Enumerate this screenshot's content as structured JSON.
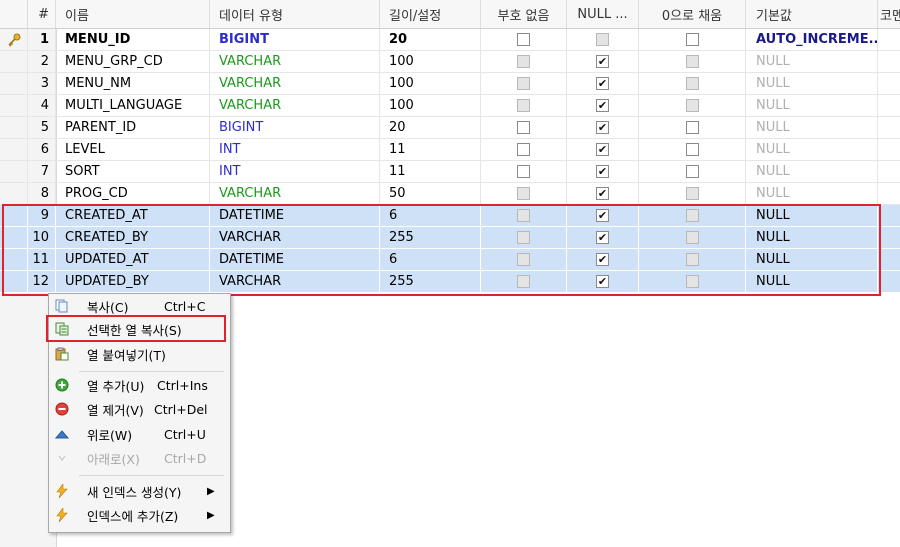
{
  "columns": {
    "num": "#",
    "name": "이름",
    "type": "데이터 유형",
    "length": "길이/설정",
    "unsigned": "부호 없음",
    "null": "NULL ...",
    "zerofill": "0으로 채움",
    "default": "기본값",
    "comment": "코멘"
  },
  "rows": [
    {
      "num": "1",
      "name": "MENU_ID",
      "type": "BIGINT",
      "length": "20",
      "unsigned": false,
      "null": false,
      "zerofill": false,
      "default": "AUTO_INCREME...",
      "primary_key": true
    },
    {
      "num": "2",
      "name": "MENU_GRP_CD",
      "type": "VARCHAR",
      "length": "100",
      "unsigned": false,
      "null": true,
      "zerofill": false,
      "default": "NULL"
    },
    {
      "num": "3",
      "name": "MENU_NM",
      "type": "VARCHAR",
      "length": "100",
      "unsigned": false,
      "null": true,
      "zerofill": false,
      "default": "NULL"
    },
    {
      "num": "4",
      "name": "MULTI_LANGUAGE",
      "type": "VARCHAR",
      "length": "100",
      "unsigned": false,
      "null": true,
      "zerofill": false,
      "default": "NULL"
    },
    {
      "num": "5",
      "name": "PARENT_ID",
      "type": "BIGINT",
      "length": "20",
      "unsigned": false,
      "null": true,
      "zerofill": false,
      "default": "NULL"
    },
    {
      "num": "6",
      "name": "LEVEL",
      "type": "INT",
      "length": "11",
      "unsigned": false,
      "null": true,
      "zerofill": false,
      "default": "NULL"
    },
    {
      "num": "7",
      "name": "SORT",
      "type": "INT",
      "length": "11",
      "unsigned": false,
      "null": true,
      "zerofill": false,
      "default": "NULL"
    },
    {
      "num": "8",
      "name": "PROG_CD",
      "type": "VARCHAR",
      "length": "50",
      "unsigned": false,
      "null": true,
      "zerofill": false,
      "default": "NULL"
    },
    {
      "num": "9",
      "name": "CREATED_AT",
      "type": "DATETIME",
      "length": "6",
      "unsigned": false,
      "null": true,
      "zerofill": false,
      "default": "NULL",
      "selected": true
    },
    {
      "num": "10",
      "name": "CREATED_BY",
      "type": "VARCHAR",
      "length": "255",
      "unsigned": false,
      "null": true,
      "zerofill": false,
      "default": "NULL",
      "selected": true
    },
    {
      "num": "11",
      "name": "UPDATED_AT",
      "type": "DATETIME",
      "length": "6",
      "unsigned": false,
      "null": true,
      "zerofill": false,
      "default": "NULL",
      "selected": true
    },
    {
      "num": "12",
      "name": "UPDATED_BY",
      "type": "VARCHAR",
      "length": "255",
      "unsigned": false,
      "null": true,
      "zerofill": false,
      "default": "NULL",
      "selected": true
    }
  ],
  "context_menu": {
    "items": [
      {
        "label": "복사(C)",
        "shortcut": "Ctrl+C",
        "icon": "copy-icon",
        "enabled": true
      },
      {
        "label": "선택한 열 복사(S)",
        "shortcut": "",
        "icon": "copy-columns-icon",
        "enabled": true,
        "highlighted": true
      },
      {
        "label": "열 붙여넣기(T)",
        "shortcut": "",
        "icon": "paste-icon",
        "enabled": true
      },
      {
        "label": "열 추가(U)",
        "shortcut": "Ctrl+Ins",
        "icon": "add-circle-icon",
        "enabled": true
      },
      {
        "label": "열 제거(V)",
        "shortcut": "Ctrl+Del",
        "icon": "remove-circle-icon",
        "enabled": true
      },
      {
        "label": "위로(W)",
        "shortcut": "Ctrl+U",
        "icon": "arrow-up-icon",
        "enabled": true
      },
      {
        "label": "아래로(X)",
        "shortcut": "Ctrl+D",
        "icon": "arrow-down-icon",
        "enabled": false
      },
      {
        "label": "새 인덱스 생성(Y)",
        "shortcut": "",
        "icon": "lightning-icon",
        "enabled": true,
        "submenu": true
      },
      {
        "label": "인덱스에 추가(Z)",
        "shortcut": "",
        "icon": "lightning-icon",
        "enabled": true,
        "submenu": true
      }
    ]
  },
  "colors": {
    "selection": "#cfe1f6",
    "highlight_border": "#e0232a",
    "type_varchar": "#1b9a1b",
    "type_numeric": "#2d2dcf",
    "auto_increment": "#1a1a8c",
    "null_text": "#b0b0b0"
  }
}
